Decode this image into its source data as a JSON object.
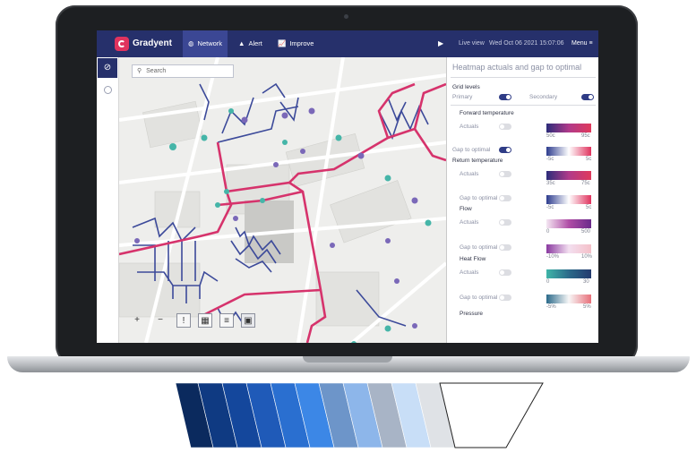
{
  "header": {
    "brand": "Gradyent",
    "nav": [
      {
        "label": "Network",
        "icon": "globe-icon",
        "active": true
      },
      {
        "label": "Alert",
        "icon": "alert-triangle-icon",
        "active": false
      },
      {
        "label": "Improve",
        "icon": "trend-chart-icon",
        "active": false
      }
    ],
    "play_icon": "play-icon",
    "live_view": "Live view",
    "datetime": "Wed Oct 06 2021 15:07:06",
    "menu": "Menu"
  },
  "sidebar": {
    "active_icon": "compass-icon"
  },
  "map": {
    "search_placeholder": "Search",
    "tools": [
      {
        "label": "+",
        "icon": "zoom-in-icon"
      },
      {
        "label": "−",
        "icon": "zoom-out-icon"
      },
      {
        "label": "!",
        "icon": "alert-box-icon"
      },
      {
        "label": "▦",
        "icon": "map-layers-icon"
      },
      {
        "label": "≡",
        "icon": "sliders-icon"
      },
      {
        "label": "▣",
        "icon": "image-icon"
      }
    ]
  },
  "panel": {
    "title": "Heatmap actuals and gap to optimal",
    "grid_levels": "Grid levels",
    "primary": "Primary",
    "secondary": "Secondary",
    "actuals": "Actuals",
    "gap_to_optimal": "Gap to optimal",
    "sections": [
      {
        "name": "Forward temperature",
        "actual_scale": [
          "50c",
          "95c"
        ],
        "gap_scale": [
          "-5c",
          "5c"
        ]
      },
      {
        "name": "Return temperature",
        "actual_scale": [
          "35c",
          "75c"
        ],
        "gap_scale": [
          "-5c",
          "5c"
        ]
      },
      {
        "name": "Flow",
        "actual_scale": [
          "0",
          "500"
        ],
        "gap_scale": [
          "-10%",
          "10%"
        ]
      },
      {
        "name": "Heat Flow",
        "actual_scale": [
          "0",
          "30"
        ],
        "gap_scale": [
          "-5%",
          "5%"
        ]
      },
      {
        "name": "Pressure"
      }
    ]
  },
  "colors": {
    "header": "#26306b",
    "accent": "#e0335e",
    "pipe_primary": "#d6336c",
    "pipe_secondary": "#3c4a9a"
  }
}
